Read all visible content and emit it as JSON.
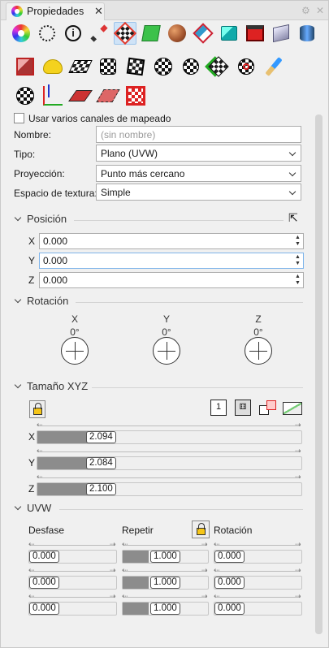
{
  "window": {
    "title": "Propiedades"
  },
  "colors": {
    "selected_tab": "#cfe3f7",
    "slider_fill": "#8c8c8c",
    "accent": "#e33a2d",
    "lock_yellow": "#f5c518"
  },
  "toolbar": {
    "icons": [
      "color-wheel-icon",
      "circle-dashed-icon",
      "info-icon",
      "pencil-icon",
      "texture-mapping-icon",
      "green-plane-icon",
      "sphere-texture-icon",
      "mapping-grid-icon",
      "box-teal-icon",
      "red-panel-icon",
      "sheet-icon",
      "cylinder-icon"
    ],
    "selected_index": 4
  },
  "tools": {
    "row1": [
      "cube-mapping-icon",
      "duck-icon",
      "plane-checker-icon",
      "add-checker-icon",
      "box-checker-icon",
      "sphere-checker-icon",
      "add-checker-2-icon",
      "checker-arrows-icon",
      "remove-checker-icon",
      "brush-icon"
    ],
    "row2": [
      "cylinder-checker-icon",
      "widget-icon",
      "plane-red-icon",
      "plane-dashed-icon",
      "checker-red-icon"
    ]
  },
  "mapping": {
    "multi_channel_label": "Usar varios canales de mapeado",
    "multi_channel_checked": false,
    "name_label": "Nombre:",
    "name_placeholder": "(sin nombre)",
    "type_label": "Tipo:",
    "type_value": "Plano (UVW)",
    "projection_label": "Proyección:",
    "projection_value": "Punto más cercano",
    "space_label": "Espacio de textura:",
    "space_value": "Simple"
  },
  "position": {
    "title": "Posición",
    "rows": [
      {
        "axis": "X",
        "value": "0.000"
      },
      {
        "axis": "Y",
        "value": "0.000"
      },
      {
        "axis": "Z",
        "value": "0.000"
      }
    ]
  },
  "rotation": {
    "title": "Rotación",
    "axes": [
      {
        "axis": "X",
        "value": "0°"
      },
      {
        "axis": "Y",
        "value": "0°"
      },
      {
        "axis": "Z",
        "value": "0°"
      }
    ]
  },
  "size": {
    "title": "Tamaño XYZ",
    "rows": [
      {
        "axis": "X",
        "value": "2.094",
        "fraction": 0.2
      },
      {
        "axis": "Y",
        "value": "2.084",
        "fraction": 0.2
      },
      {
        "axis": "Z",
        "value": "2.100",
        "fraction": 0.2
      }
    ],
    "icons": [
      "box-1-icon",
      "box-dice-icon",
      "box-scale-icon",
      "ratio-icon"
    ]
  },
  "uvw": {
    "title": "UVW",
    "offset_label": "Desfase",
    "repeat_label": "Repetir",
    "rotation_label": "Rotación",
    "offset": [
      "0.000",
      "0.000",
      "0.000"
    ],
    "repeat": [
      {
        "value": "1.000",
        "fraction": 0.3
      },
      {
        "value": "1.000",
        "fraction": 0.3
      },
      {
        "value": "1.000",
        "fraction": 0.3
      }
    ],
    "rotation": [
      "0.000",
      "0.000",
      "0.000"
    ]
  }
}
